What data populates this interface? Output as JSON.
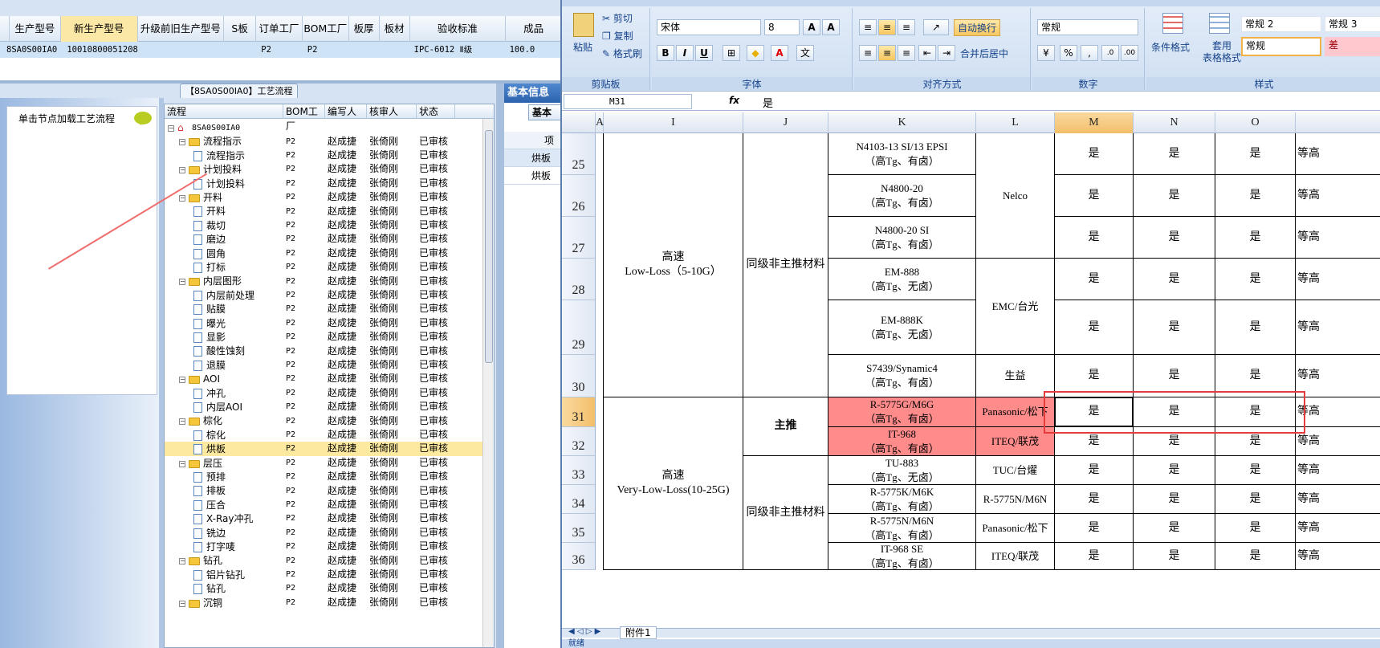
{
  "left_app": {
    "top_grid": {
      "headers": [
        "生产型号",
        "新生产型号",
        "升级前旧生产型号",
        "S板",
        "订单工厂",
        "BOM工厂",
        "板厚",
        "板材",
        "验收标准",
        "成品"
      ],
      "row": [
        "8SA0S00IA0",
        "10010800051208",
        "",
        "",
        "P2",
        "P2",
        "",
        "",
        "IPC-6012 Ⅱ级",
        "100.0"
      ]
    },
    "tab_title": "【8SA0S00IA0】工艺流程",
    "left_hint": "单击节点加载工艺流程",
    "tree_headers": [
      "流程",
      "BOM工厂",
      "编写人",
      "核审人",
      "状态"
    ],
    "tree_rows": [
      {
        "name": "8SA0S00IA0",
        "type": "home",
        "level": 0,
        "bom": "",
        "writer": "",
        "reviewer": "",
        "status": ""
      },
      {
        "name": "流程指示",
        "type": "folder",
        "level": 1,
        "bom": "P2",
        "writer": "赵成捷",
        "reviewer": "张倚刚",
        "status": "已审核"
      },
      {
        "name": "流程指示",
        "type": "doc",
        "level": 2,
        "bom": "P2",
        "writer": "赵成捷",
        "reviewer": "张倚刚",
        "status": "已审核"
      },
      {
        "name": "计划投料",
        "type": "folder",
        "level": 1,
        "bom": "P2",
        "writer": "赵成捷",
        "reviewer": "张倚刚",
        "status": "已审核"
      },
      {
        "name": "计划投料",
        "type": "doc",
        "level": 2,
        "bom": "P2",
        "writer": "赵成捷",
        "reviewer": "张倚刚",
        "status": "已审核"
      },
      {
        "name": "开料",
        "type": "folder",
        "level": 1,
        "bom": "P2",
        "writer": "赵成捷",
        "reviewer": "张倚刚",
        "status": "已审核"
      },
      {
        "name": "开料",
        "type": "doc",
        "level": 2,
        "bom": "P2",
        "writer": "赵成捷",
        "reviewer": "张倚刚",
        "status": "已审核"
      },
      {
        "name": "裁切",
        "type": "doc",
        "level": 2,
        "bom": "P2",
        "writer": "赵成捷",
        "reviewer": "张倚刚",
        "status": "已审核"
      },
      {
        "name": "磨边",
        "type": "doc",
        "level": 2,
        "bom": "P2",
        "writer": "赵成捷",
        "reviewer": "张倚刚",
        "status": "已审核"
      },
      {
        "name": "圆角",
        "type": "doc",
        "level": 2,
        "bom": "P2",
        "writer": "赵成捷",
        "reviewer": "张倚刚",
        "status": "已审核"
      },
      {
        "name": "打标",
        "type": "doc",
        "level": 2,
        "bom": "P2",
        "writer": "赵成捷",
        "reviewer": "张倚刚",
        "status": "已审核"
      },
      {
        "name": "内层图形",
        "type": "folder",
        "level": 1,
        "bom": "P2",
        "writer": "赵成捷",
        "reviewer": "张倚刚",
        "status": "已审核"
      },
      {
        "name": "内层前处理",
        "type": "doc",
        "level": 2,
        "bom": "P2",
        "writer": "赵成捷",
        "reviewer": "张倚刚",
        "status": "已审核"
      },
      {
        "name": "贴膜",
        "type": "doc",
        "level": 2,
        "bom": "P2",
        "writer": "赵成捷",
        "reviewer": "张倚刚",
        "status": "已审核"
      },
      {
        "name": "曝光",
        "type": "doc",
        "level": 2,
        "bom": "P2",
        "writer": "赵成捷",
        "reviewer": "张倚刚",
        "status": "已审核"
      },
      {
        "name": "显影",
        "type": "doc",
        "level": 2,
        "bom": "P2",
        "writer": "赵成捷",
        "reviewer": "张倚刚",
        "status": "已审核"
      },
      {
        "name": "酸性蚀刻",
        "type": "doc",
        "level": 2,
        "bom": "P2",
        "writer": "赵成捷",
        "reviewer": "张倚刚",
        "status": "已审核"
      },
      {
        "name": "退膜",
        "type": "doc",
        "level": 2,
        "bom": "P2",
        "writer": "赵成捷",
        "reviewer": "张倚刚",
        "status": "已审核"
      },
      {
        "name": "AOI",
        "type": "folder",
        "level": 1,
        "bom": "P2",
        "writer": "赵成捷",
        "reviewer": "张倚刚",
        "status": "已审核"
      },
      {
        "name": "冲孔",
        "type": "doc",
        "level": 2,
        "bom": "P2",
        "writer": "赵成捷",
        "reviewer": "张倚刚",
        "status": "已审核"
      },
      {
        "name": "内层AOI",
        "type": "doc",
        "level": 2,
        "bom": "P2",
        "writer": "赵成捷",
        "reviewer": "张倚刚",
        "status": "已审核"
      },
      {
        "name": "棕化",
        "type": "folder",
        "level": 1,
        "bom": "P2",
        "writer": "赵成捷",
        "reviewer": "张倚刚",
        "status": "已审核"
      },
      {
        "name": "棕化",
        "type": "doc",
        "level": 2,
        "bom": "P2",
        "writer": "赵成捷",
        "reviewer": "张倚刚",
        "status": "已审核"
      },
      {
        "name": "烘板",
        "type": "doc",
        "level": 2,
        "bom": "P2",
        "writer": "赵成捷",
        "reviewer": "张倚刚",
        "status": "已审核",
        "selected": true
      },
      {
        "name": "层压",
        "type": "folder",
        "level": 1,
        "bom": "P2",
        "writer": "赵成捷",
        "reviewer": "张倚刚",
        "status": "已审核"
      },
      {
        "name": "预排",
        "type": "doc",
        "level": 2,
        "bom": "P2",
        "writer": "赵成捷",
        "reviewer": "张倚刚",
        "status": "已审核"
      },
      {
        "name": "排板",
        "type": "doc",
        "level": 2,
        "bom": "P2",
        "writer": "赵成捷",
        "reviewer": "张倚刚",
        "status": "已审核"
      },
      {
        "name": "压合",
        "type": "doc",
        "level": 2,
        "bom": "P2",
        "writer": "赵成捷",
        "reviewer": "张倚刚",
        "status": "已审核"
      },
      {
        "name": "X-Ray冲孔",
        "type": "doc",
        "level": 2,
        "bom": "P2",
        "writer": "赵成捷",
        "reviewer": "张倚刚",
        "status": "已审核"
      },
      {
        "name": "铣边",
        "type": "doc",
        "level": 2,
        "bom": "P2",
        "writer": "赵成捷",
        "reviewer": "张倚刚",
        "status": "已审核"
      },
      {
        "name": "打字唛",
        "type": "doc",
        "level": 2,
        "bom": "P2",
        "writer": "赵成捷",
        "reviewer": "张倚刚",
        "status": "已审核"
      },
      {
        "name": "钻孔",
        "type": "folder",
        "level": 1,
        "bom": "P2",
        "writer": "赵成捷",
        "reviewer": "张倚刚",
        "status": "已审核"
      },
      {
        "name": "铝片钻孔",
        "type": "doc",
        "level": 2,
        "bom": "P2",
        "writer": "赵成捷",
        "reviewer": "张倚刚",
        "status": "已审核"
      },
      {
        "name": "钻孔",
        "type": "doc",
        "level": 2,
        "bom": "P2",
        "writer": "赵成捷",
        "reviewer": "张倚刚",
        "status": "已审核"
      },
      {
        "name": "沉铜",
        "type": "folder",
        "level": 1,
        "bom": "P2",
        "writer": "赵成捷",
        "reviewer": "张倚刚",
        "status": "已审核"
      }
    ],
    "basic_info": {
      "tab": "基本信息",
      "subtab": "基本",
      "col": "项",
      "rows": [
        "烘板",
        "烘板"
      ]
    }
  },
  "excel": {
    "clipboard": {
      "paste": "粘贴",
      "cut": "剪切",
      "copy": "复制",
      "format_painter": "格式刷",
      "label": "剪贴板"
    },
    "font": {
      "name": "宋体",
      "size": "8",
      "label": "字体",
      "bold": "B",
      "italic": "I",
      "underline": "U"
    },
    "alignment": {
      "wrap": "自动换行",
      "merge": "合并后居中",
      "label": "对齐方式"
    },
    "number": {
      "format": "常规",
      "label": "数字"
    },
    "styles": {
      "conditional": "条件格式",
      "table_format": "套用\n表格格式",
      "s1": "常规 2",
      "s2": "常规 3",
      "s3": "常规",
      "s4": "差",
      "label": "样式"
    },
    "name_box": "M31",
    "fx": "fx",
    "formula_value": "是",
    "columns": [
      "A",
      "I",
      "J",
      "K",
      "L",
      "M",
      "N",
      "O"
    ],
    "selected_column": "M",
    "row_numbers": [
      "25",
      "26",
      "27",
      "28",
      "29",
      "30",
      "31",
      "32",
      "33",
      "34",
      "35",
      "36"
    ],
    "selected_row": "31",
    "cells": {
      "speed_low": "高速\nLow-Loss（5-10G）",
      "speed_vlow": "高速\nVery-Low-Loss(10-25G)",
      "same_grade_1": "同级非主推材料",
      "main_push": "主推",
      "same_grade_2": "同级非主推材料",
      "k25": "N4103-13 SI/13 EPSI\n（高Tg、有卤）",
      "k26": "N4800-20\n（高Tg、有卤）",
      "k27": "N4800-20 SI\n（高Tg、有卤）",
      "k28": "EM-888\n（高Tg、无卤）",
      "k29": "EM-888K\n（高Tg、无卤）",
      "k30": "S7439/Synamic4\n（高Tg、有卤）",
      "k31": "R-5775G/M6G\n（高Tg、有卤）",
      "k32": "IT-968\n（高Tg、有卤）",
      "k33": "TU-883\n（高Tg、无卤）",
      "k34": "R-5775K/M6K\n（高Tg、有卤）",
      "k35": "R-5775N/M6N\n（高Tg、有卤）",
      "k36": "IT-968 SE\n（高Tg、有卤）",
      "l_nelco": "Nelco",
      "l_emc": "EMC/台光",
      "l_sy": "生益",
      "l31": "Panasonic/松下",
      "l32": "ITEQ/联茂",
      "l33": "TUC/台燿",
      "l34": "R-5775N/M6N",
      "l35": "Panasonic/松下",
      "l36": "ITEQ/联茂",
      "yes": "是",
      "p_edge": "等高"
    },
    "sheet_tab": "附件1",
    "status": "就绪"
  }
}
